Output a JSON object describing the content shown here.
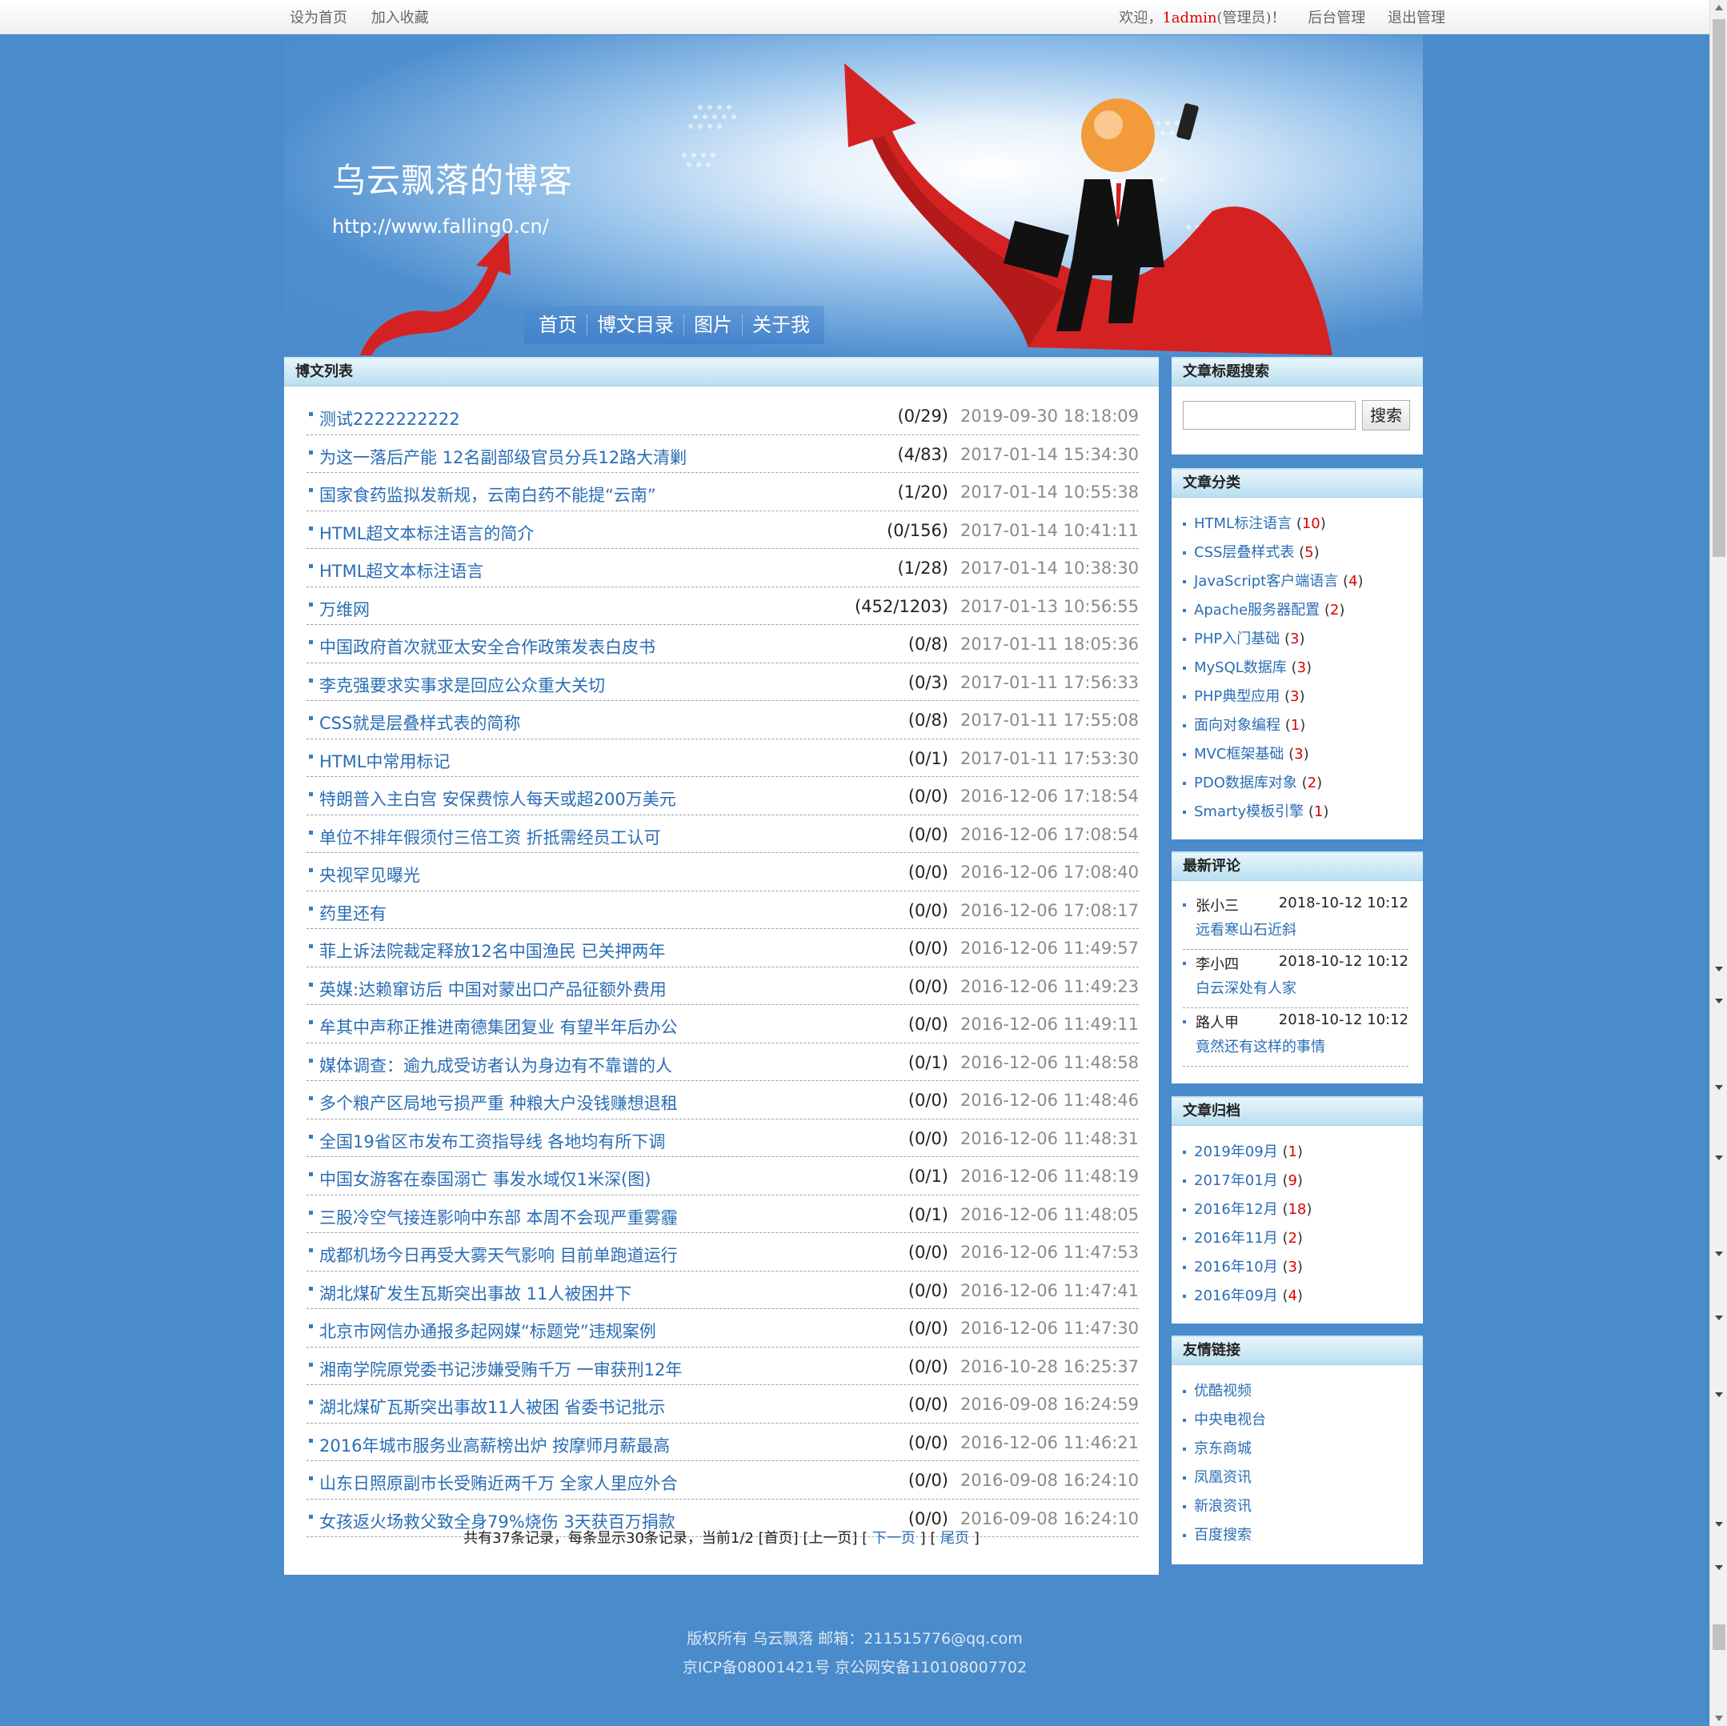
{
  "topbar": {
    "set_home": "设为首页",
    "add_fav": "加入收藏",
    "welcome_prefix": "欢迎，",
    "user": "1admin",
    "welcome_suffix": "(管理员)！",
    "admin": "后台管理",
    "logout": "退出管理"
  },
  "header": {
    "title": "乌云飘落的博客",
    "url": "http://www.falling0.cn/"
  },
  "nav": [
    "首页",
    "博文目录",
    "图片",
    "关于我"
  ],
  "main": {
    "heading": "博文列表",
    "posts": [
      {
        "title": "测试2222222222",
        "stats": "(0/29)",
        "date": "2019-09-30 18:18:09"
      },
      {
        "title": "为这一落后产能 12名副部级官员分兵12路大清剿",
        "stats": "(4/83)",
        "date": "2017-01-14 15:34:30"
      },
      {
        "title": "国家食药监拟发新规，云南白药不能提“云南”",
        "stats": "(1/20)",
        "date": "2017-01-14 10:55:38"
      },
      {
        "title": "HTML超文本标注语言的简介",
        "stats": "(0/156)",
        "date": "2017-01-14 10:41:11"
      },
      {
        "title": "HTML超文本标注语言",
        "stats": "(1/28)",
        "date": "2017-01-14 10:38:30"
      },
      {
        "title": "万维网",
        "stats": "(452/1203)",
        "date": "2017-01-13 10:56:55"
      },
      {
        "title": "中国政府首次就亚太安全合作政策发表白皮书",
        "stats": "(0/8)",
        "date": "2017-01-11 18:05:36"
      },
      {
        "title": "李克强要求实事求是回应公众重大关切",
        "stats": "(0/3)",
        "date": "2017-01-11 17:56:33"
      },
      {
        "title": "CSS就是层叠样式表的简称",
        "stats": "(0/8)",
        "date": "2017-01-11 17:55:08"
      },
      {
        "title": "HTML中常用标记",
        "stats": "(0/1)",
        "date": "2017-01-11 17:53:30"
      },
      {
        "title": "特朗普入主白宫 安保费惊人每天或超200万美元",
        "stats": "(0/0)",
        "date": "2016-12-06 17:18:54"
      },
      {
        "title": "单位不排年假须付三倍工资 折抵需经员工认可",
        "stats": "(0/0)",
        "date": "2016-12-06 17:08:54"
      },
      {
        "title": "央视罕见曝光",
        "stats": "(0/0)",
        "date": "2016-12-06 17:08:40"
      },
      {
        "title": "药里还有",
        "stats": "(0/0)",
        "date": "2016-12-06 17:08:17"
      },
      {
        "title": "菲上诉法院裁定释放12名中国渔民 已关押两年",
        "stats": "(0/0)",
        "date": "2016-12-06 11:49:57"
      },
      {
        "title": "英媒:达赖窜访后 中国对蒙出口产品征额外费用",
        "stats": "(0/0)",
        "date": "2016-12-06 11:49:23"
      },
      {
        "title": "牟其中声称正推进南德集团复业 有望半年后办公",
        "stats": "(0/0)",
        "date": "2016-12-06 11:49:11"
      },
      {
        "title": "媒体调查：逾九成受访者认为身边有不靠谱的人",
        "stats": "(0/1)",
        "date": "2016-12-06 11:48:58"
      },
      {
        "title": "多个粮产区局地亏损严重 种粮大户没钱赚想退租",
        "stats": "(0/0)",
        "date": "2016-12-06 11:48:46"
      },
      {
        "title": "全国19省区市发布工资指导线 各地均有所下调",
        "stats": "(0/0)",
        "date": "2016-12-06 11:48:31"
      },
      {
        "title": "中国女游客在泰国溺亡 事发水域仅1米深(图)",
        "stats": "(0/1)",
        "date": "2016-12-06 11:48:19"
      },
      {
        "title": "三股冷空气接连影响中东部 本周不会现严重雾霾",
        "stats": "(0/1)",
        "date": "2016-12-06 11:48:05"
      },
      {
        "title": "成都机场今日再受大雾天气影响 目前单跑道运行",
        "stats": "(0/0)",
        "date": "2016-12-06 11:47:53"
      },
      {
        "title": "湖北煤矿发生瓦斯突出事故 11人被困井下",
        "stats": "(0/0)",
        "date": "2016-12-06 11:47:41"
      },
      {
        "title": "北京市网信办通报多起网媒“标题党”违规案例",
        "stats": "(0/0)",
        "date": "2016-12-06 11:47:30"
      },
      {
        "title": "湘南学院原党委书记涉嫌受贿千万 一审获刑12年",
        "stats": "(0/0)",
        "date": "2016-10-28 16:25:37"
      },
      {
        "title": "湖北煤矿瓦斯突出事故11人被困 省委书记批示",
        "stats": "(0/0)",
        "date": "2016-09-08 16:24:59"
      },
      {
        "title": "2016年城市服务业高薪榜出炉 按摩师月薪最高",
        "stats": "(0/0)",
        "date": "2016-12-06 11:46:21"
      },
      {
        "title": "山东日照原副市长受贿近两千万 全家人里应外合",
        "stats": "(0/0)",
        "date": "2016-09-08 16:24:10"
      },
      {
        "title": "女孩返火场救父致全身79%烧伤 3天获百万捐款",
        "stats": "(0/0)",
        "date": "2016-09-08 16:24:10"
      }
    ],
    "pager": {
      "summary": "共有37条记录，每条显示30条记录，当前1/2",
      "first": "[首页]",
      "prev": "[上一页]",
      "next": "下一页",
      "last": "尾页"
    }
  },
  "sidebar": {
    "search": {
      "heading": "文章标题搜索",
      "button": "搜索",
      "value": ""
    },
    "categories": {
      "heading": "文章分类",
      "items": [
        {
          "name": "HTML标注语言",
          "count": "10"
        },
        {
          "name": "CSS层叠样式表",
          "count": "5"
        },
        {
          "name": "JavaScript客户端语言",
          "count": "4"
        },
        {
          "name": "Apache服务器配置",
          "count": "2"
        },
        {
          "name": "PHP入门基础",
          "count": "3"
        },
        {
          "name": "MySQL数据库",
          "count": "3"
        },
        {
          "name": "PHP典型应用",
          "count": "3"
        },
        {
          "name": "面向对象编程",
          "count": "1"
        },
        {
          "name": "MVC框架基础",
          "count": "3"
        },
        {
          "name": "PDO数据库对象",
          "count": "2"
        },
        {
          "name": "Smarty模板引擎",
          "count": "1"
        }
      ]
    },
    "comments": {
      "heading": "最新评论",
      "items": [
        {
          "user": "张小三",
          "time": "2018-10-12 10:12",
          "text": "远看寒山石近斜"
        },
        {
          "user": "李小四",
          "time": "2018-10-12 10:12",
          "text": "白云深处有人家"
        },
        {
          "user": "路人甲",
          "time": "2018-10-12 10:12",
          "text": "竟然还有这样的事情"
        }
      ]
    },
    "archive": {
      "heading": "文章归档",
      "items": [
        {
          "name": "2019年09月",
          "count": "1"
        },
        {
          "name": "2017年01月",
          "count": "9"
        },
        {
          "name": "2016年12月",
          "count": "18"
        },
        {
          "name": "2016年11月",
          "count": "2"
        },
        {
          "name": "2016年10月",
          "count": "3"
        },
        {
          "name": "2016年09月",
          "count": "4"
        }
      ]
    },
    "links": {
      "heading": "友情链接",
      "items": [
        "优酷视频",
        "中央电视台",
        "京东商城",
        "凤凰资讯",
        "新浪资讯",
        "百度搜索"
      ]
    }
  },
  "footer": {
    "line1": "版权所有 乌云飘落   邮箱：211515776@qq.com",
    "line2": "京ICP备08001421号 京公网安备110108007702"
  },
  "colors": {
    "background": "#4a8bcb",
    "link": "#2a6db5",
    "count": "#dd0000"
  }
}
